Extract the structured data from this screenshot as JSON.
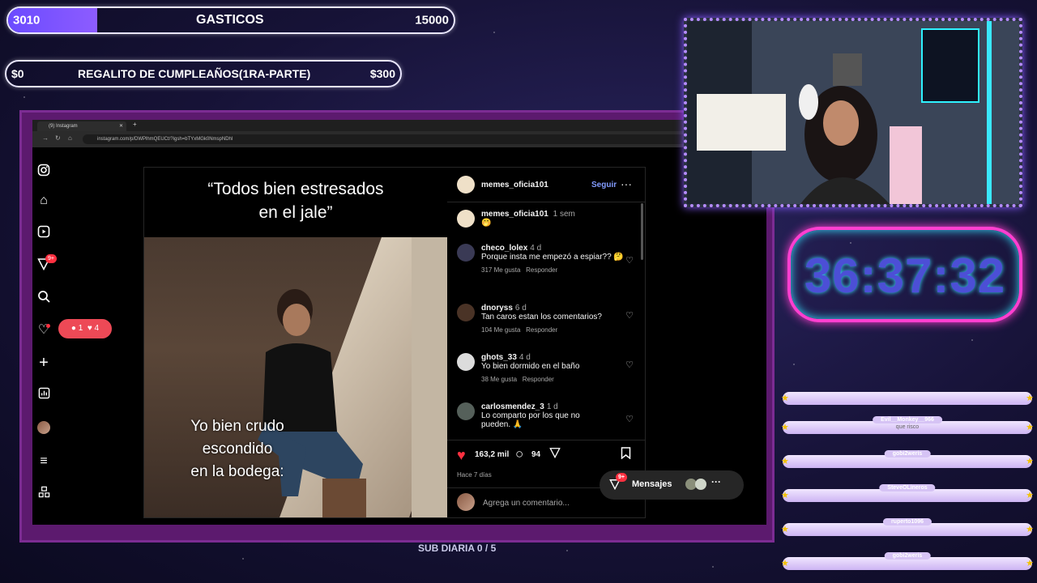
{
  "goals": [
    {
      "left": "3010",
      "title": "GASTICOS",
      "right": "15000"
    },
    {
      "left": "$0",
      "title": "REGALITO DE CUMPLEAÑOS(1RA-PARTE)",
      "right": "$300"
    }
  ],
  "browser": {
    "tab_label": "(9) Instagram",
    "url": "instagram.com/p/DWPlhmQEUCt/?igsh=bTYxMGk0NmspNDhl"
  },
  "post": {
    "top_text": "“Todos bien estresados\nen el jale”",
    "bottom_text": "Yo bien crudo\nescondido\nen la bodega:",
    "author": "memes_oficia101",
    "follow_label": "Seguir",
    "more_icon": "more-dots-icon",
    "caption_author": "memes_oficia101",
    "caption_time": "1 sem",
    "caption_emoji": "🤭",
    "likes": "163,2 mil",
    "comment_count": "94",
    "time_ago": "Hace 7 días",
    "add_comment_placeholder": "Agrega un comentario..."
  },
  "comments": [
    {
      "user": "checo_lolex",
      "time": "4 d",
      "text": "Porque insta me empezó a espiar?? 🤔",
      "likes": "317 Me gusta",
      "reply": "Responder"
    },
    {
      "user": "dnoryss",
      "time": "6 d",
      "text": "Tan caros estan los comentarios?",
      "likes": "104 Me gusta",
      "reply": "Responder"
    },
    {
      "user": "ghots_33",
      "time": "4 d",
      "text": "Yo bien dormido en el baño",
      "likes": "38 Me gusta",
      "reply": "Responder"
    },
    {
      "user": "carlosmendez_3",
      "time": "1 d",
      "text": "Lo comparto por los que no pueden. 🙏",
      "likes": "",
      "reply": ""
    }
  ],
  "sidebar": {
    "notif_badge": "9+",
    "activity_pill": {
      "comments": "1",
      "likes": "4"
    }
  },
  "messages": {
    "badge": "9+",
    "label": "Mensajes"
  },
  "timer": "36:37:32",
  "chat": [
    {
      "user": "",
      "msg": ""
    },
    {
      "user": "Evil__Monkey__966",
      "msg": "que risco"
    },
    {
      "user": "gobi2weris",
      "msg": ""
    },
    {
      "user": "SteveOLineros",
      "msg": ""
    },
    {
      "user": "ruperto1096",
      "msg": ""
    },
    {
      "user": "gobi2weris",
      "msg": ""
    }
  ],
  "sub_goal": "SUB DIARIA 0 / 5",
  "colors": {
    "accent": "#8d5cff",
    "like": "#ed4956",
    "link": "#0095f6",
    "timer_border": "#ff3fd0"
  }
}
